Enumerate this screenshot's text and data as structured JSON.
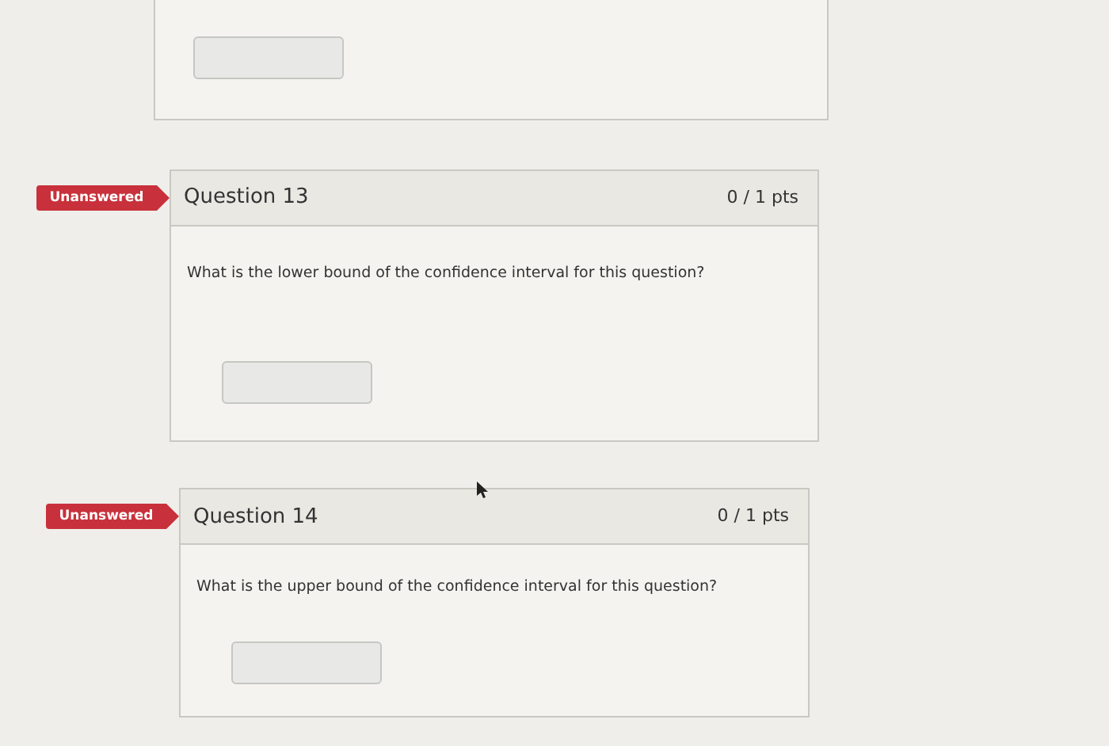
{
  "questions": [
    {
      "status": "Unanswered",
      "title": "Question 13",
      "points": "0 / 1 pts",
      "text": "What is the lower bound of the confidence interval for this question?"
    },
    {
      "status": "Unanswered",
      "title": "Question 14",
      "points": "0 / 1 pts",
      "text": "What is the upper bound of the confidence interval for this question?"
    }
  ]
}
